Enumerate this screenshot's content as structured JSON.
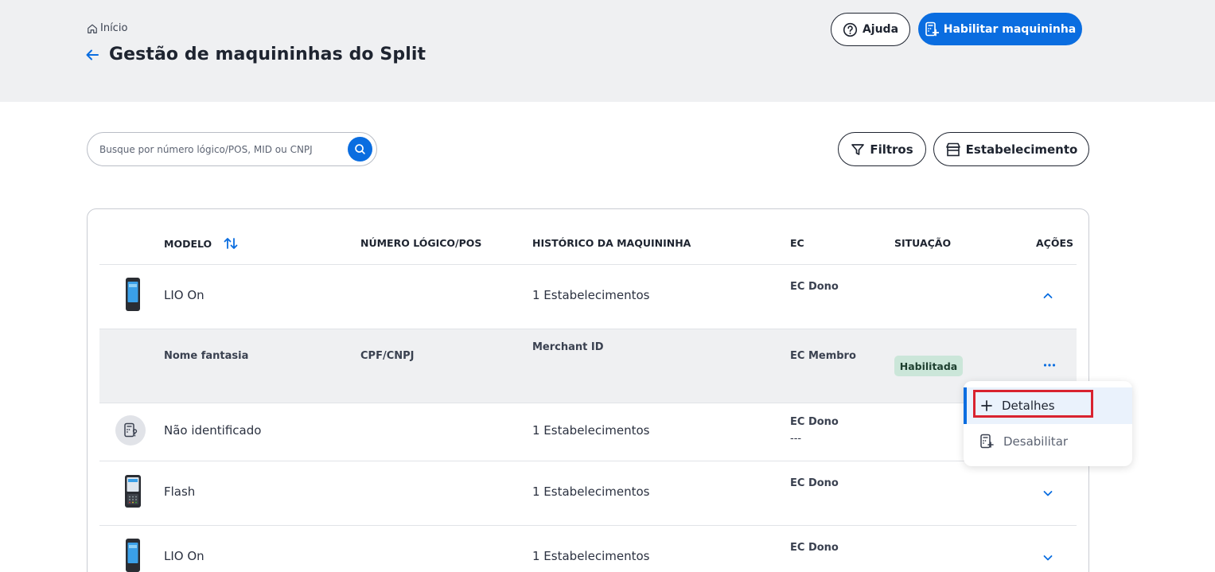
{
  "header": {
    "breadcrumb": "Início",
    "title": "Gestão de maquininhas do Split",
    "help_label": "Ajuda",
    "enable_label": "Habilitar maquininha"
  },
  "toolbar": {
    "search_placeholder": "Busque por número lógico/POS, MID ou CNPJ",
    "filters_label": "Filtros",
    "establishment_label": "Estabelecimento"
  },
  "table": {
    "columns": {
      "model": "MODELO",
      "logical_number": "NÚMERO LÓGICO/POS",
      "history": "HISTÓRICO DA MAQUININHA",
      "ec": "EC",
      "status": "SITUAÇÃO",
      "actions": "AÇÕES"
    },
    "rows": [
      {
        "model": "LIO On",
        "history": "1 Estabelecimentos",
        "ec": "EC Dono",
        "expanded": true
      },
      {
        "model": "Não identificado",
        "history": "1 Estabelecimentos",
        "ec": "EC Dono",
        "ec_value": "---"
      },
      {
        "model": "Flash",
        "history": "1 Estabelecimentos",
        "ec": "EC Dono"
      },
      {
        "model": "LIO On",
        "history": "1 Estabelecimentos",
        "ec": "EC Dono"
      }
    ],
    "expanded_detail": {
      "trade_name": "Nome fantasia",
      "document": "CPF/CNPJ",
      "merchant_id": "Merchant ID",
      "ec": "EC Membro",
      "status": "Habilitada"
    }
  },
  "actions_menu": {
    "details_label": "Detalhes",
    "disable_label": "Desabilitar"
  },
  "colors": {
    "primary": "#0a6de0",
    "header_bg": "#eff0f2",
    "badge_bg": "#cbe6d9",
    "highlight": "#d9232f"
  }
}
